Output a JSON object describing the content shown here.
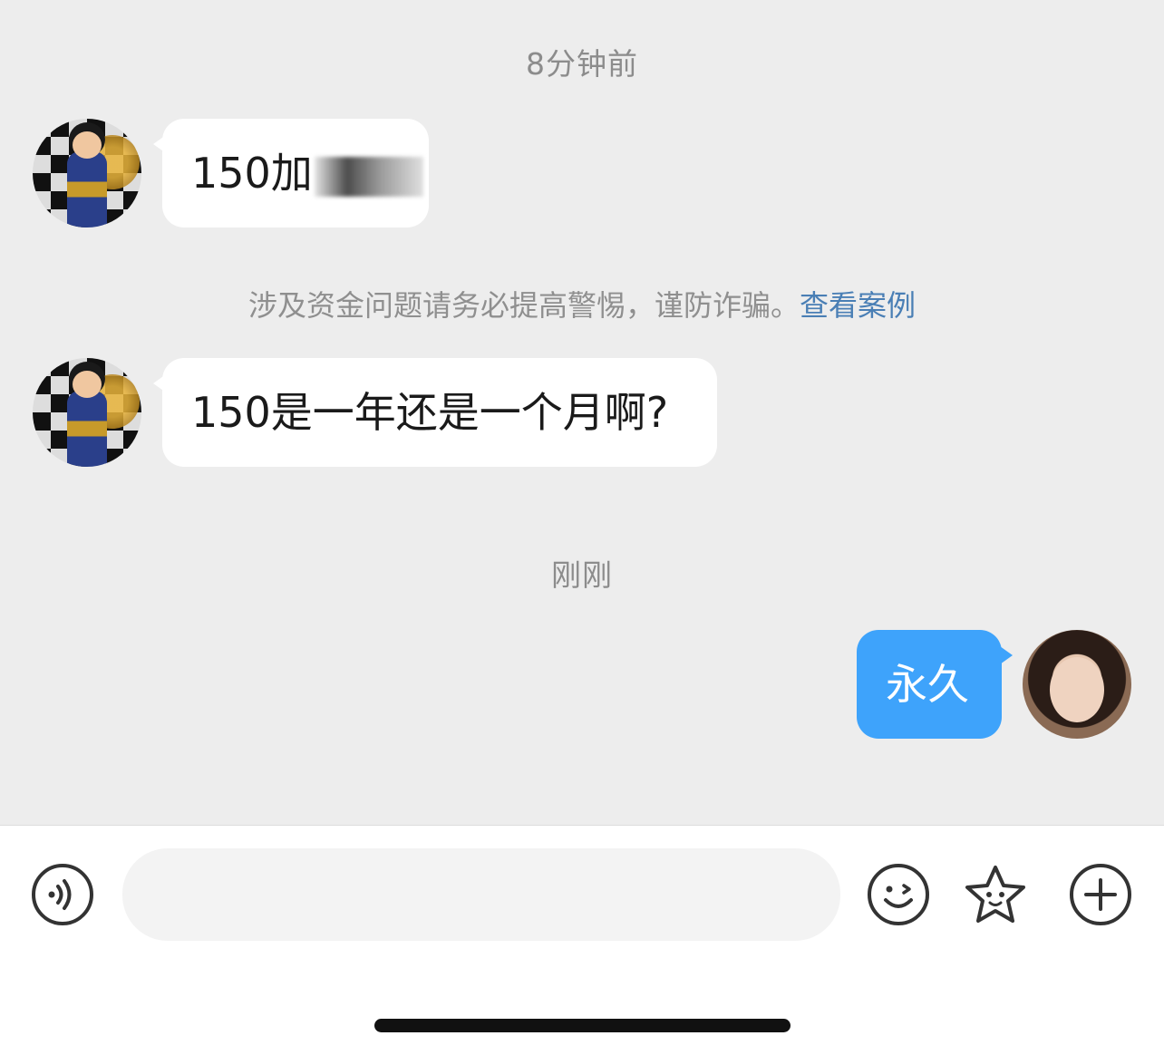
{
  "messages": {
    "time_1": "8分钟前",
    "msg_1": "150加",
    "msg_1_tail": "信",
    "notice_text": "涉及资金问题请务必提高警惕，谨防诈骗。",
    "notice_link": "查看案例",
    "msg_2": "150是一年还是一个月啊?",
    "time_2": "刚刚",
    "msg_3": "永久"
  },
  "input": {
    "placeholder": ""
  },
  "icons": {
    "voice": "voice-icon",
    "emoji": "emoji-icon",
    "sticker": "star-sticker-icon",
    "add": "plus-icon"
  },
  "colors": {
    "background": "#ededed",
    "incoming_bubble": "#ffffff",
    "outgoing_bubble": "#3ea3fb",
    "link": "#4a7fb5"
  }
}
